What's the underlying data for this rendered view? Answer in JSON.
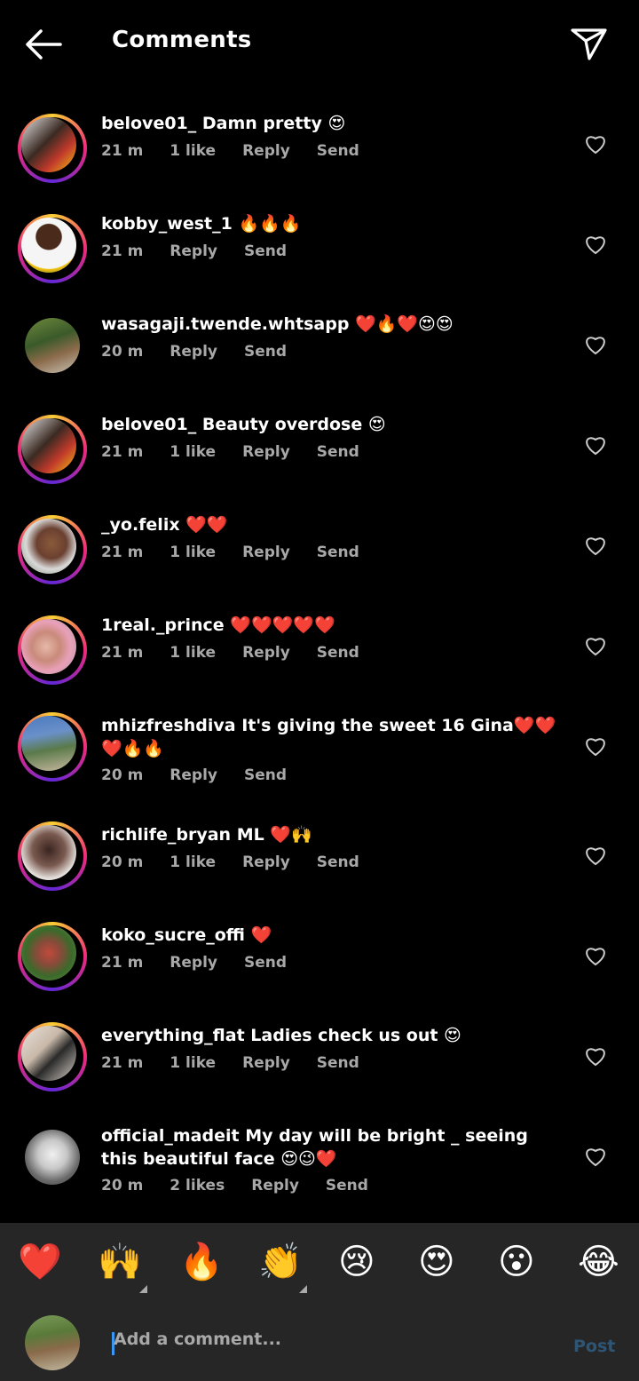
{
  "header": {
    "title": "Comments"
  },
  "comments": [
    {
      "user": "belove01_",
      "text": "Damn pretty 😍",
      "time": "21 m",
      "likes": "1 like",
      "reply": "Reply",
      "send": "Send"
    },
    {
      "user": "kobby_west_1",
      "text": "🔥🔥🔥",
      "time": "21 m",
      "likes": "",
      "reply": "Reply",
      "send": "Send"
    },
    {
      "user": "wasagaji.twende.whtsapp",
      "text": "❤️🔥❤️😍😍",
      "time": "20 m",
      "likes": "",
      "reply": "Reply",
      "send": "Send"
    },
    {
      "user": "belove01_",
      "text": "Beauty overdose 😍",
      "time": "21 m",
      "likes": "1 like",
      "reply": "Reply",
      "send": "Send"
    },
    {
      "user": "_yo.felix",
      "text": "❤️❤️",
      "time": "21 m",
      "likes": "1 like",
      "reply": "Reply",
      "send": "Send"
    },
    {
      "user": "1real._prince",
      "text": "❤️❤️❤️❤️❤️",
      "time": "21 m",
      "likes": "1 like",
      "reply": "Reply",
      "send": "Send"
    },
    {
      "user": "mhizfreshdiva",
      "text": "It's giving the sweet 16 Gina❤️❤️❤️🔥🔥",
      "time": "20 m",
      "likes": "",
      "reply": "Reply",
      "send": "Send"
    },
    {
      "user": "richlife_bryan",
      "text": "ML ❤️🙌",
      "time": "20 m",
      "likes": "1 like",
      "reply": "Reply",
      "send": "Send"
    },
    {
      "user": "koko_sucre_offi",
      "text": "❤️",
      "time": "21 m",
      "likes": "",
      "reply": "Reply",
      "send": "Send"
    },
    {
      "user": "everything_flat",
      "text": "Ladies check us out 😍",
      "time": "21 m",
      "likes": "1 like",
      "reply": "Reply",
      "send": "Send"
    },
    {
      "user": "official_madeit",
      "text": "My day will be bright _ seeing this beautiful face 😍😉❤️",
      "time": "20 m",
      "likes": "2 likes",
      "reply": "Reply",
      "send": "Send"
    }
  ],
  "reactions": [
    "❤️",
    "🙌",
    "🔥",
    "👏",
    "😢",
    "😍",
    "😮",
    "😂"
  ],
  "composer": {
    "placeholder": "Add a comment...",
    "post_label": "Post"
  },
  "colors": {
    "accent_link": "#2f5575",
    "muted_text": "#a8a8a8",
    "bar_bg": "#262626"
  }
}
